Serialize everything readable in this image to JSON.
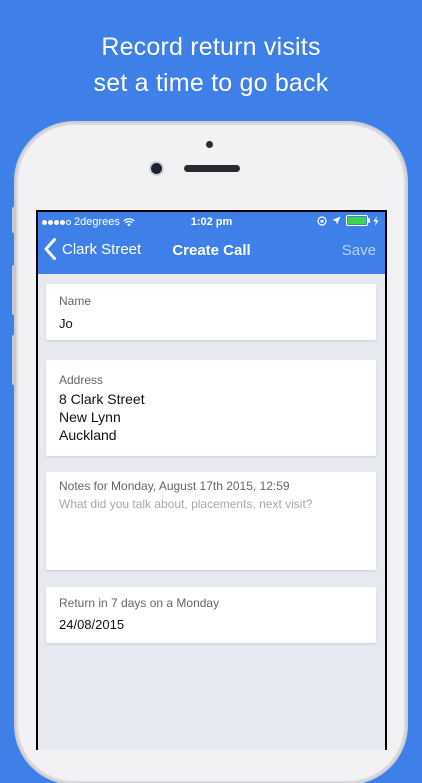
{
  "headline": {
    "line1": "Record return visits",
    "line2": "set a time to go back"
  },
  "status_bar": {
    "carrier": "2degrees",
    "time": "1:02 pm"
  },
  "nav": {
    "back_label": "Clark Street",
    "title": "Create Call",
    "save_label": "Save"
  },
  "form": {
    "name": {
      "label": "Name",
      "value": "Jo"
    },
    "address": {
      "label": "Address",
      "lines": [
        "8 Clark Street",
        "New Lynn",
        "Auckland"
      ]
    },
    "notes": {
      "label": "Notes for Monday, August 17th 2015, 12:59",
      "placeholder": "What did you talk about, placements, next visit?"
    },
    "return": {
      "label": "Return in 7 days on a Monday",
      "value": "24/08/2015"
    }
  },
  "colors": {
    "brand_blue": "#3e7fe8",
    "background": "#e6e9f0",
    "battery": "#3bd44a"
  }
}
